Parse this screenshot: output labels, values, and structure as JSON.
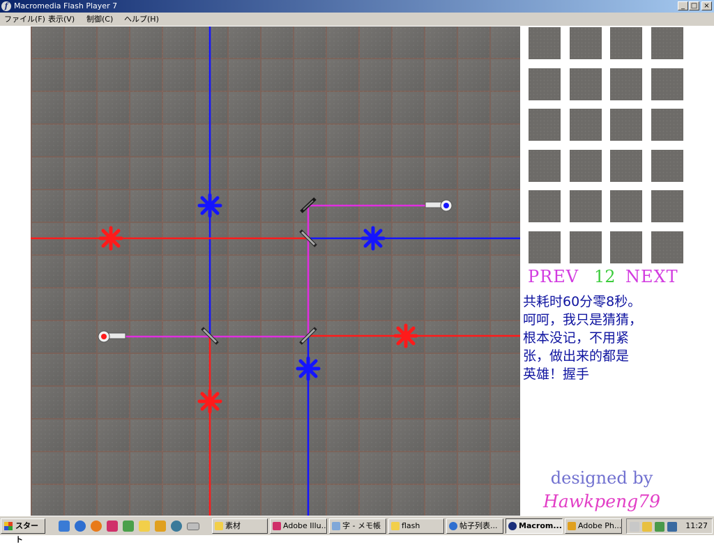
{
  "window": {
    "title": "Macromedia Flash Player 7",
    "app_icon": "flash-icon",
    "controls": {
      "minimize": "_",
      "maximize": "□",
      "close": "×"
    }
  },
  "menu": {
    "items": [
      "ファイル(F)",
      "表示(V)",
      "制御(C)",
      "ヘルプ(H)"
    ]
  },
  "game": {
    "grid_columns": 15,
    "grid_rows": 15,
    "colors": {
      "red": "#ff1a1a",
      "blue": "#1414ff",
      "magenta": "#e02ee0",
      "mirror": "#9a9a9a",
      "board": "#6e6c69"
    },
    "emitters": [
      {
        "color": "red",
        "icon": "red-emitter-icon"
      },
      {
        "color": "blue",
        "icon": "blue-emitter-icon"
      }
    ],
    "stars": [
      {
        "color": "red"
      },
      {
        "color": "red"
      },
      {
        "color": "red"
      },
      {
        "color": "blue"
      },
      {
        "color": "blue"
      },
      {
        "color": "blue"
      }
    ]
  },
  "level_select": {
    "tile_count": 24,
    "prev_label": "PREV",
    "level": "12",
    "next_label": "NEXT"
  },
  "message": "共耗时60分零8秒。\n呵呵，我只是猜猜，\n根本没记，不用紧\n张，做出来的都是\n英雄！握手",
  "credit": {
    "line1": "designed by",
    "line2": "Hawkpeng79"
  },
  "taskbar": {
    "start_label": "スタート",
    "quick_launch": [
      "desktop-icon",
      "ie-icon",
      "outlook-icon",
      "illustrator-icon",
      "pen-icon",
      "folder-icon",
      "photoshop-icon",
      "app-icon",
      "tray-icon"
    ],
    "tasks": [
      {
        "label": "素材",
        "icon": "folder-icon",
        "active": false
      },
      {
        "label": "Adobe Illu...",
        "icon": "illustrator-icon",
        "active": false
      },
      {
        "label": "字 - メモ帳",
        "icon": "notepad-icon",
        "active": false
      },
      {
        "label": "flash",
        "icon": "folder-icon",
        "active": false
      },
      {
        "label": "帖子列表...",
        "icon": "browser-icon",
        "active": false
      },
      {
        "label": "Macrom...",
        "icon": "flash-icon",
        "active": true
      },
      {
        "label": "Adobe Ph...",
        "icon": "photoshop-icon",
        "active": false
      }
    ],
    "clock": "11:27"
  }
}
